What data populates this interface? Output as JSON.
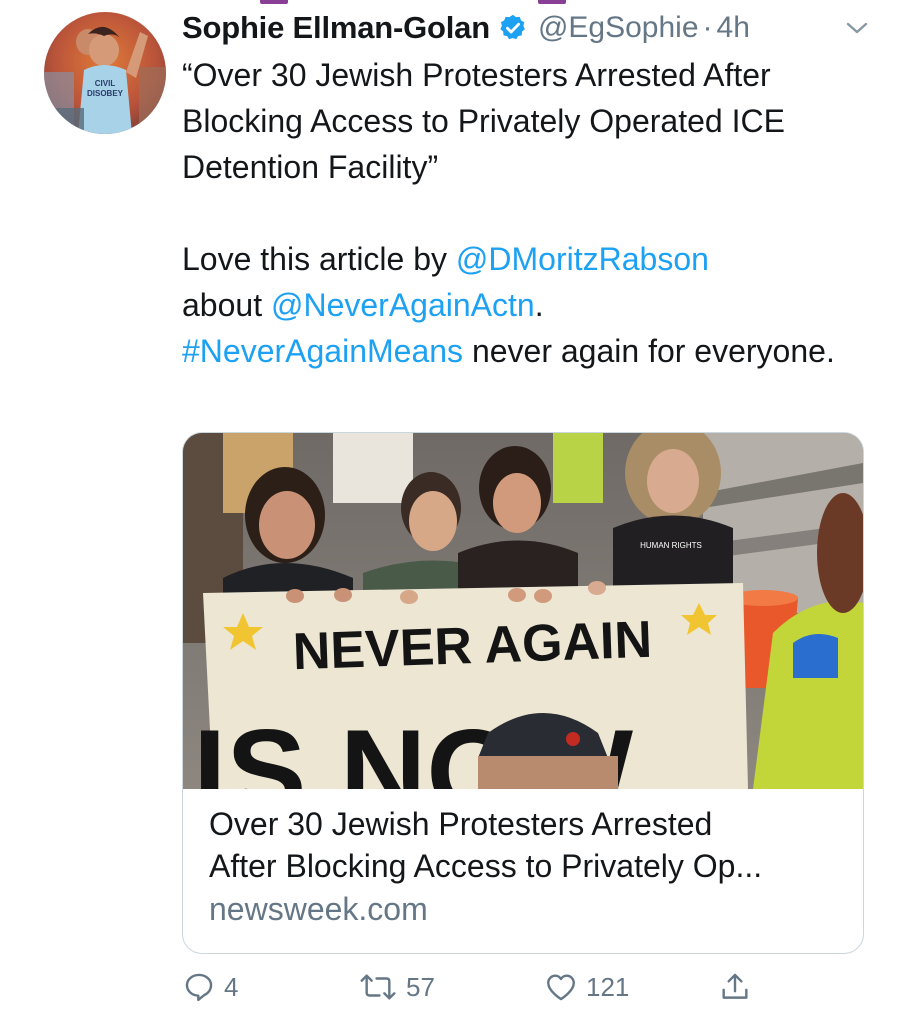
{
  "tweet": {
    "author_name": "Sophie Ellman-Golan",
    "handle": "@EgSophie",
    "separator": "·",
    "time": "4h",
    "quote_line": "“Over 30 Jewish Protesters Arrested After Blocking Access to Privately Operated ICE Detention Facility”",
    "line2_prefix": "Love this article by ",
    "mention_1": "@DMoritzRabson",
    "line3_prefix": "about ",
    "mention_2": "@NeverAgainActn",
    "line3_suffix": ".",
    "hashtag": "#NeverAgainMeans",
    "closing": " never again for everyone."
  },
  "card": {
    "title_line1": "Over 30 Jewish Protesters Arrested",
    "title_line2": "After Blocking Access to Privately Op...",
    "domain": "newsweek.com",
    "image": {
      "banner_line1": "NEVER AGAIN",
      "banner_line2": "IS NOW",
      "shirt_text": "HUMAN RIGHTS",
      "avatar_shirt": "CIVIL DISOBEY"
    }
  },
  "actions": {
    "replies": "4",
    "retweets": "57",
    "likes": "121"
  },
  "colors": {
    "link": "#1da1f2",
    "muted": "#657786",
    "text": "#14171a",
    "verified": "#1da1f2"
  }
}
